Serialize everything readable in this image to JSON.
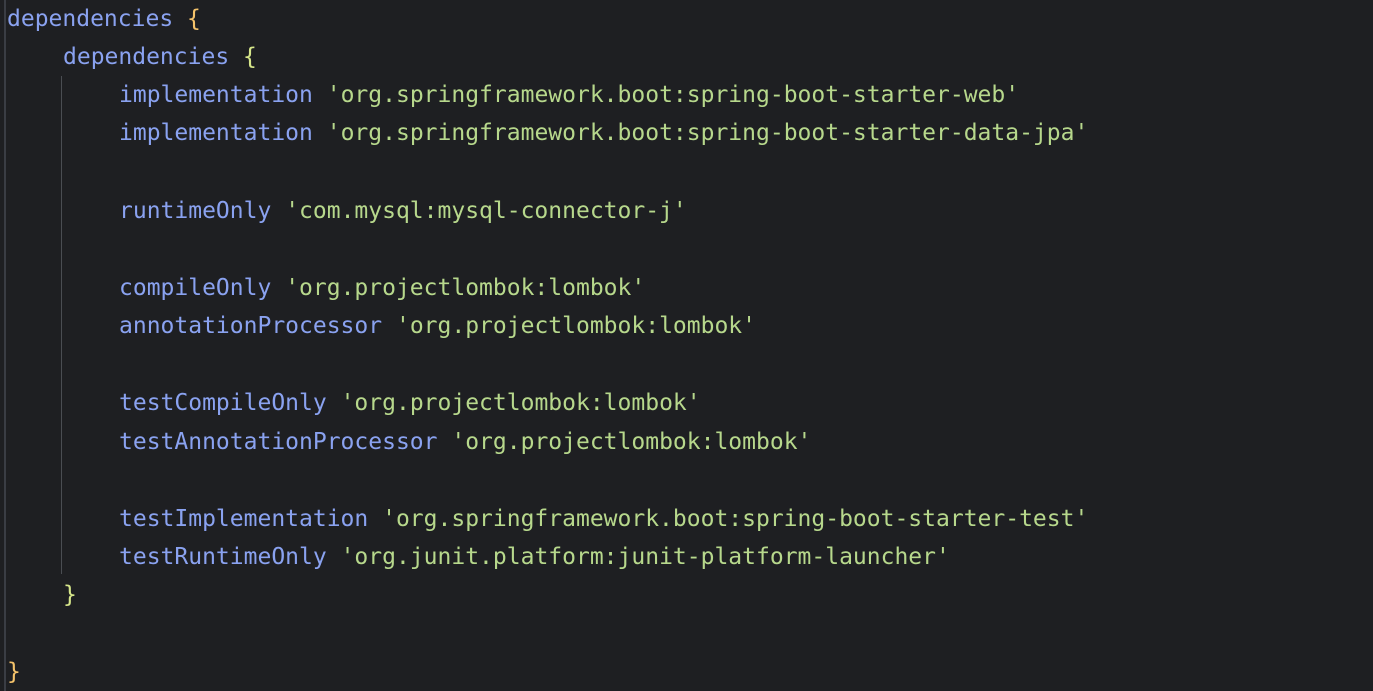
{
  "editor": {
    "colors": {
      "background": "#1e1f22",
      "keyword": "#8aa2f0",
      "string": "#b7d88c",
      "outer_brace": "#f5c36b",
      "inner_brace": "#d6e68a"
    },
    "lines": [
      {
        "name": "outer-dependencies",
        "keyword": "dependencies",
        "suffix": "{"
      },
      {
        "name": "inner-dependencies",
        "keyword": "dependencies",
        "suffix": "{"
      },
      {
        "name": "impl-web",
        "keyword": "implementation",
        "value": "'org.springframework.boot:spring-boot-starter-web'"
      },
      {
        "name": "impl-data-jpa",
        "keyword": "implementation",
        "value": "'org.springframework.boot:spring-boot-starter-data-jpa'"
      },
      {
        "name": "runtime-mysql",
        "keyword": "runtimeOnly",
        "value": "'com.mysql:mysql-connector-j'"
      },
      {
        "name": "compile-lombok",
        "keyword": "compileOnly",
        "value": "'org.projectlombok:lombok'"
      },
      {
        "name": "annotation-lombok",
        "keyword": "annotationProcessor",
        "value": "'org.projectlombok:lombok'"
      },
      {
        "name": "test-compile-lombok",
        "keyword": "testCompileOnly",
        "value": "'org.projectlombok:lombok'"
      },
      {
        "name": "test-annotation-lombok",
        "keyword": "testAnnotationProcessor",
        "value": "'org.projectlombok:lombok'"
      },
      {
        "name": "test-impl-starter-test",
        "keyword": "testImplementation",
        "value": "'org.springframework.boot:spring-boot-starter-test'"
      },
      {
        "name": "test-runtime-junit",
        "keyword": "testRuntimeOnly",
        "value": "'org.junit.platform:junit-platform-launcher'"
      },
      {
        "name": "inner-close",
        "suffix": "}"
      },
      {
        "name": "outer-close",
        "suffix": "}"
      }
    ]
  }
}
